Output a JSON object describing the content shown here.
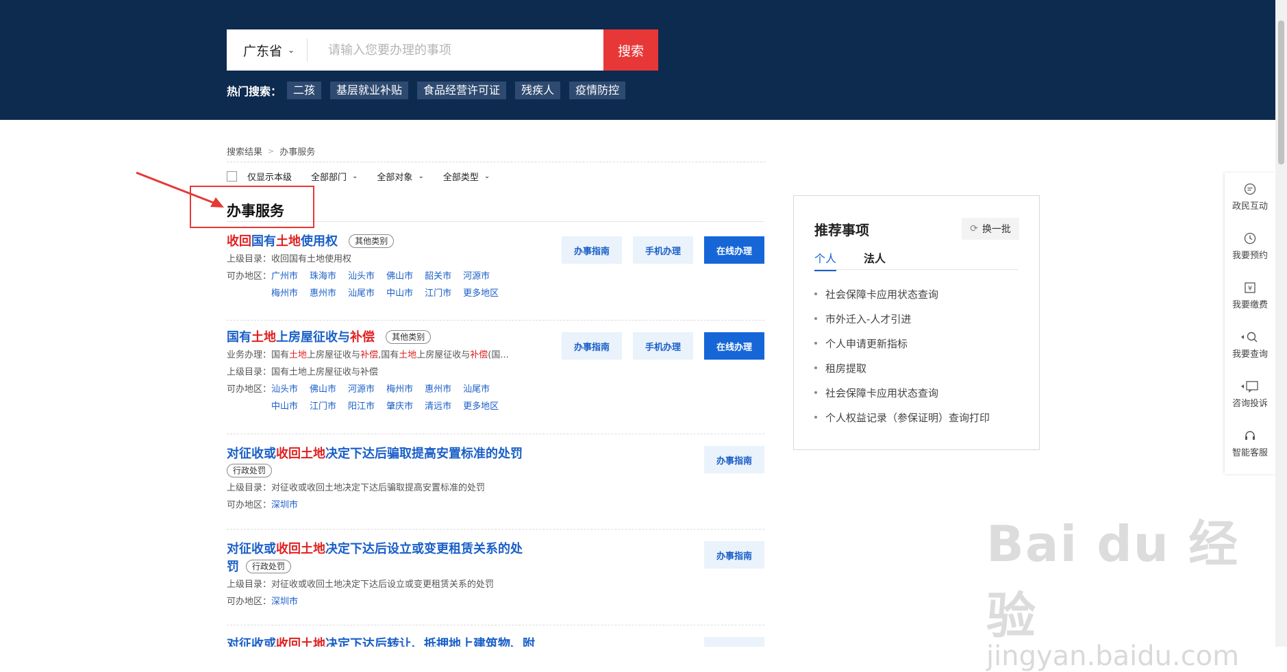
{
  "search": {
    "province": "广东省",
    "placeholder": "请输入您要办理的事项",
    "button": "搜索",
    "hot_label": "热门搜索：",
    "hot_tags": [
      "二孩",
      "基层就业补贴",
      "食品经营许可证",
      "残疾人",
      "疫情防控"
    ]
  },
  "breadcrumb": [
    "搜索结果",
    "办事服务"
  ],
  "filters": {
    "only_local": "仅显示本级",
    "dept": "全部部门",
    "target": "全部对象",
    "type": "全部类型"
  },
  "section_title": "办事服务",
  "buttons": {
    "guide": "办事指南",
    "mobile": "手机办理",
    "online": "在线办理"
  },
  "results": [
    {
      "title_parts": [
        [
          "收回",
          true
        ],
        [
          "国有",
          false
        ],
        [
          "土地",
          true
        ],
        [
          "使用权",
          false
        ]
      ],
      "tag": "其他类别",
      "business": null,
      "parent_label": "上级目录：",
      "parent": "收回国有土地使用权",
      "region_label": "可办地区：",
      "regions": [
        "广州市",
        "珠海市",
        "汕头市",
        "佛山市",
        "韶关市",
        "河源市",
        "梅州市",
        "惠州市",
        "汕尾市",
        "中山市",
        "江门市",
        "更多地区"
      ]
    },
    {
      "title_parts": [
        [
          "国有",
          false
        ],
        [
          "土地",
          true
        ],
        [
          "上房屋征收与",
          false
        ],
        [
          "补偿",
          true
        ]
      ],
      "tag": "其他类别",
      "business_label": "业务办理：",
      "business_parts": [
        [
          "国有",
          false
        ],
        [
          "土地",
          true
        ],
        [
          "上房屋征收与",
          false
        ],
        [
          "补偿",
          true
        ],
        [
          ",国有",
          false
        ],
        [
          "土地",
          true
        ],
        [
          "上房屋征收与",
          false
        ],
        [
          "补偿",
          true
        ],
        [
          "(国...",
          false
        ]
      ],
      "parent_label": "上级目录：",
      "parent": "国有土地上房屋征收与补偿",
      "region_label": "可办地区：",
      "regions": [
        "汕头市",
        "佛山市",
        "河源市",
        "梅州市",
        "惠州市",
        "汕尾市",
        "中山市",
        "江门市",
        "阳江市",
        "肇庆市",
        "清远市",
        "更多地区"
      ]
    },
    {
      "title_parts": [
        [
          "对征收或",
          false
        ],
        [
          "收回土地",
          true
        ],
        [
          "决定下达后骗取提高安置标准的处罚",
          false
        ]
      ],
      "tag": "行政处罚",
      "parent_label": "上级目录：",
      "parent": "对征收或收回土地决定下达后骗取提高安置标准的处罚",
      "region_label": "可办地区：",
      "regions": [
        "深圳市"
      ]
    },
    {
      "title_parts": [
        [
          "对征收或",
          false
        ],
        [
          "收回土地",
          true
        ],
        [
          "决定下达后设立或变更租赁关系的处",
          false
        ]
      ],
      "title_line2": "罚",
      "tag": "行政处罚",
      "parent_label": "上级目录：",
      "parent": "对征收或收回土地决定下达后设立或变更租赁关系的处罚",
      "region_label": "可办地区：",
      "regions": [
        "深圳市"
      ]
    },
    {
      "title_parts": [
        [
          "对征收或",
          false
        ],
        [
          "收回土地",
          true
        ],
        [
          "决定下达后转让、抵押地上建筑物、附",
          false
        ]
      ]
    }
  ],
  "panel": {
    "title": "推荐事项",
    "refresh": "换一批",
    "tabs": [
      "个人",
      "法人"
    ],
    "items": [
      "社会保障卡应用状态查询",
      "市外迁入-人才引进",
      "个人申请更新指标",
      "租房提取",
      "社会保障卡应用状态查询",
      "个人权益记录（参保证明）查询打印"
    ]
  },
  "sidebar": [
    "政民互动",
    "我要预约",
    "我要缴费",
    "我要查询",
    "咨询投诉",
    "智能客服"
  ],
  "watermark": {
    "top": "Bai du 经验",
    "bottom": "jingyan.baidu.com"
  },
  "colors": {
    "header_bg": "#0d2a4f",
    "accent_red": "#e83737",
    "link_blue": "#1a5fc8",
    "primary_btn": "#1666d8"
  }
}
